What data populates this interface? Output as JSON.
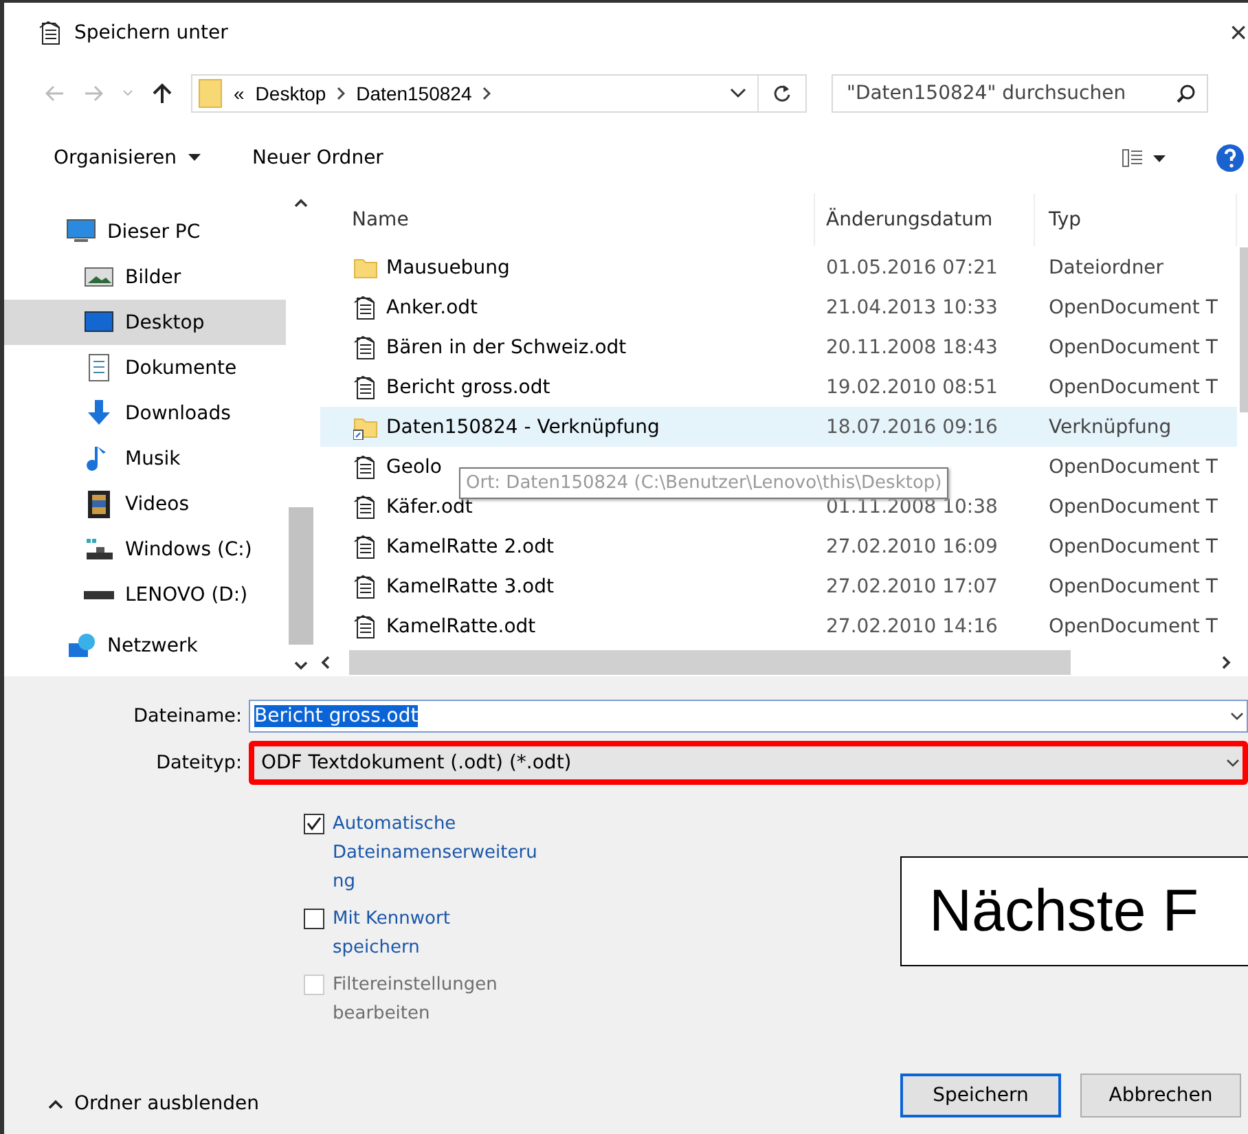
{
  "window": {
    "title": "Speichern unter",
    "close": "×"
  },
  "address_bar": {
    "crumbs": [
      "«",
      "Desktop",
      "Daten150824"
    ]
  },
  "search": {
    "placeholder": "\"Daten150824\" durchsuchen"
  },
  "toolbar": [
    {
      "label": "Organisieren",
      "kind": "menu"
    },
    {
      "label": "Neuer Ordner",
      "kind": "plain"
    }
  ],
  "sidebar": {
    "items": [
      {
        "label": "Dieser PC",
        "kind": "pc",
        "selected": false,
        "children": [
          {
            "label": "Bilder",
            "kind": "pictures",
            "selected": false
          },
          {
            "label": "Desktop",
            "kind": "desktop",
            "selected": true
          },
          {
            "label": "Dokumente",
            "kind": "documents",
            "selected": false
          },
          {
            "label": "Downloads",
            "kind": "downloads",
            "selected": false
          },
          {
            "label": "Musik",
            "kind": "music",
            "selected": false
          },
          {
            "label": "Videos",
            "kind": "videos",
            "selected": false
          },
          {
            "label": "Windows (C:)",
            "kind": "windrive",
            "selected": false
          },
          {
            "label": "LENOVO (D:)",
            "kind": "drive",
            "selected": false
          }
        ]
      },
      {
        "label": "Netzwerk",
        "kind": "network",
        "selected": false
      }
    ]
  },
  "file_list": {
    "columns": [
      "Name",
      "Änderungsdatum",
      "Typ"
    ],
    "rows": [
      {
        "name": "Mausuebung",
        "date": "01.05.2016 07:21",
        "type": "Dateiordner",
        "kind": "folder",
        "highlighted": false
      },
      {
        "name": "Anker.odt",
        "date": "21.04.2013 10:33",
        "type": "OpenDocument T",
        "kind": "document",
        "highlighted": false
      },
      {
        "name": "Bären in der Schweiz.odt",
        "date": "20.11.2008 18:43",
        "type": "OpenDocument T",
        "kind": "document",
        "highlighted": false
      },
      {
        "name": "Bericht gross.odt",
        "date": "19.02.2010 08:51",
        "type": "OpenDocument T",
        "kind": "document",
        "highlighted": false
      },
      {
        "name": "Daten150824 - Verknüpfung",
        "date": "18.07.2016 09:16",
        "type": "Verknüpfung",
        "kind": "shortcut",
        "highlighted": true
      },
      {
        "name": "Geolo",
        "type": "OpenDocument T",
        "kind": "document",
        "highlighted": false
      },
      {
        "name": "Käfer.odt",
        "date": "01.11.2008 10:38",
        "type": "OpenDocument T",
        "kind": "document",
        "highlighted": false
      },
      {
        "name": "KamelRatte 2.odt",
        "date": "27.02.2010 16:09",
        "type": "OpenDocument T",
        "kind": "document",
        "highlighted": false
      },
      {
        "name": "KamelRatte 3.odt",
        "date": "27.02.2010 17:07",
        "type": "OpenDocument T",
        "kind": "document",
        "highlighted": false
      },
      {
        "name": "KamelRatte.odt",
        "date": "27.02.2010 14:16",
        "type": "OpenDocument T",
        "kind": "document",
        "highlighted": false
      }
    ],
    "tooltip": "Ort: Daten150824 (C:\\Benutzer\\Lenovo\\this\\Desktop)"
  },
  "filename": {
    "label": "Dateiname:",
    "value": "Bericht gross.odt"
  },
  "filetype": {
    "label": "Dateityp:",
    "value": "ODF Textdokument (.odt) (*.odt)",
    "marked": true
  },
  "options": [
    {
      "label": "Automatische Dateinamenserweiterung",
      "checked": true,
      "disabled": false
    },
    {
      "label": "Mit Kennwort speichern",
      "checked": false,
      "disabled": false
    },
    {
      "label": "Filtereinstellungen bearbeiten",
      "checked": false,
      "disabled": true
    }
  ],
  "callout": "Nächste F",
  "hide_folders": "Ordner ausblenden",
  "buttons": [
    {
      "label": "Speichern",
      "default": true
    },
    {
      "label": "Abbrechen",
      "default": false
    }
  ]
}
